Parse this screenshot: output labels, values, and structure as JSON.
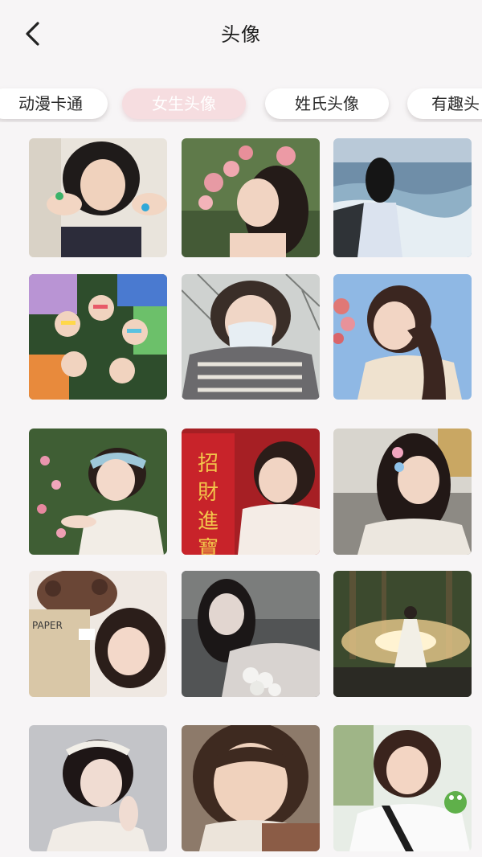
{
  "header": {
    "title": "头像",
    "back_icon": "chevron-left-icon"
  },
  "tabs": [
    {
      "label": "动漫卡通",
      "active": false
    },
    {
      "label": "女生头像",
      "active": true
    },
    {
      "label": "姓氏头像",
      "active": false
    },
    {
      "label": "有趣头",
      "active": false
    }
  ],
  "avatars": [
    {
      "row": 1,
      "col": 1,
      "scene": "girl-hands-on-face"
    },
    {
      "row": 1,
      "col": 2,
      "scene": "girl-with-pink-flowers"
    },
    {
      "row": 1,
      "col": 3,
      "scene": "girl-by-the-sea"
    },
    {
      "row": 2,
      "col": 1,
      "scene": "friends-lying-in-circle"
    },
    {
      "row": 2,
      "col": 2,
      "scene": "girl-with-mask-and-scarf"
    },
    {
      "row": 2,
      "col": 3,
      "scene": "girl-with-flowers-blue-sky"
    },
    {
      "row": 3,
      "col": 1,
      "scene": "girl-with-headband-in-garden"
    },
    {
      "row": 3,
      "col": 2,
      "scene": "girl-with-red-banner",
      "banner_text": "招財進寶"
    },
    {
      "row": 3,
      "col": 3,
      "scene": "girl-with-hair-clip"
    },
    {
      "row": 4,
      "col": 1,
      "scene": "girl-with-teddy-bear",
      "bag_text": "PAPER"
    },
    {
      "row": 4,
      "col": 2,
      "scene": "girl-holding-white-flowers"
    },
    {
      "row": 4,
      "col": 3,
      "scene": "girl-in-forest-light"
    },
    {
      "row": 5,
      "col": 1,
      "scene": "girl-with-pearl-headband"
    },
    {
      "row": 5,
      "col": 2,
      "scene": "girl-smiling-bangs"
    },
    {
      "row": 5,
      "col": 3,
      "scene": "girl-with-frog-toy"
    }
  ]
}
